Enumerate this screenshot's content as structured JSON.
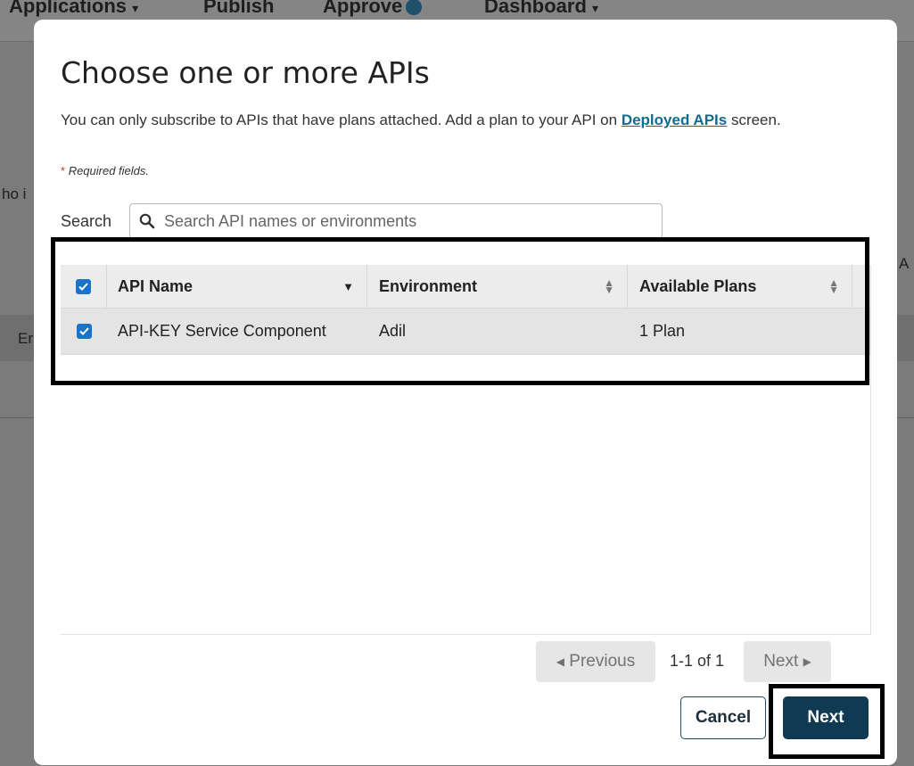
{
  "background": {
    "nav": [
      {
        "label": "Applications",
        "chevron": "▾"
      },
      {
        "label": "Publish"
      },
      {
        "label": "Approve",
        "badge": "1"
      },
      {
        "label": "Dashboard",
        "chevron": "▾"
      }
    ],
    "left_fragment_1": "ho i",
    "left_fragment_2": "Er",
    "right_fragment": "A"
  },
  "dialog": {
    "title": "Choose one or more APIs",
    "description_before": "You can only subscribe to APIs that have plans attached. Add a plan to your API on ",
    "description_link": "Deployed APIs",
    "description_after": " screen.",
    "required_star": "*",
    "required_text": "Required fields.",
    "search_label": "Search",
    "search_placeholder": "Search API names or environments",
    "table": {
      "columns": [
        "API Name",
        "Environment",
        "Available Plans"
      ],
      "rows": [
        {
          "checked": true,
          "api_name": "API-KEY Service Component",
          "environment": "Adil",
          "plans": "1 Plan"
        }
      ]
    },
    "pagination": {
      "previous_label": "Previous",
      "info": "1-1 of 1",
      "next_label": "Next"
    },
    "footer": {
      "cancel_label": "Cancel",
      "next_label": "Next"
    }
  },
  "colors": {
    "primary_button": "#0f3a52",
    "link": "#0f6e8c",
    "checkbox": "#1a72c9",
    "required_star": "#c0392b"
  }
}
